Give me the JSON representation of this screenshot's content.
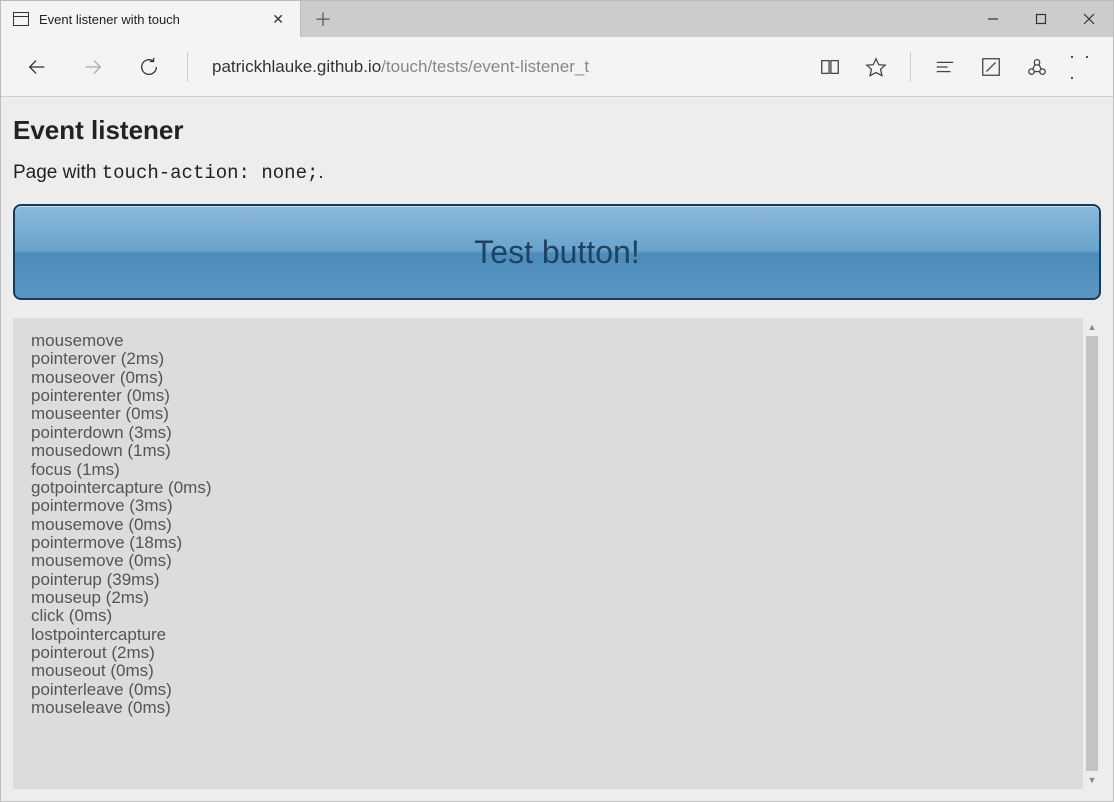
{
  "browser": {
    "tab_title": "Event listener with touch",
    "url_host": "patrickhlauke.github.io",
    "url_path": "/touch/tests/event-listener_t"
  },
  "page": {
    "heading": "Event listener",
    "subhead_prefix": "Page with ",
    "subhead_code": "touch-action: none;",
    "subhead_suffix": ".",
    "test_button_label": "Test button!"
  },
  "log": [
    "mousemove",
    "pointerover (2ms)",
    "mouseover (0ms)",
    "pointerenter (0ms)",
    "mouseenter (0ms)",
    "pointerdown (3ms)",
    "mousedown (1ms)",
    "focus (1ms)",
    "gotpointercapture (0ms)",
    "pointermove (3ms)",
    "mousemove (0ms)",
    "pointermove (18ms)",
    "mousemove (0ms)",
    "pointerup (39ms)",
    "mouseup (2ms)",
    "click (0ms)",
    "lostpointercapture",
    "pointerout (2ms)",
    "mouseout (0ms)",
    "pointerleave (0ms)",
    "mouseleave (0ms)"
  ]
}
